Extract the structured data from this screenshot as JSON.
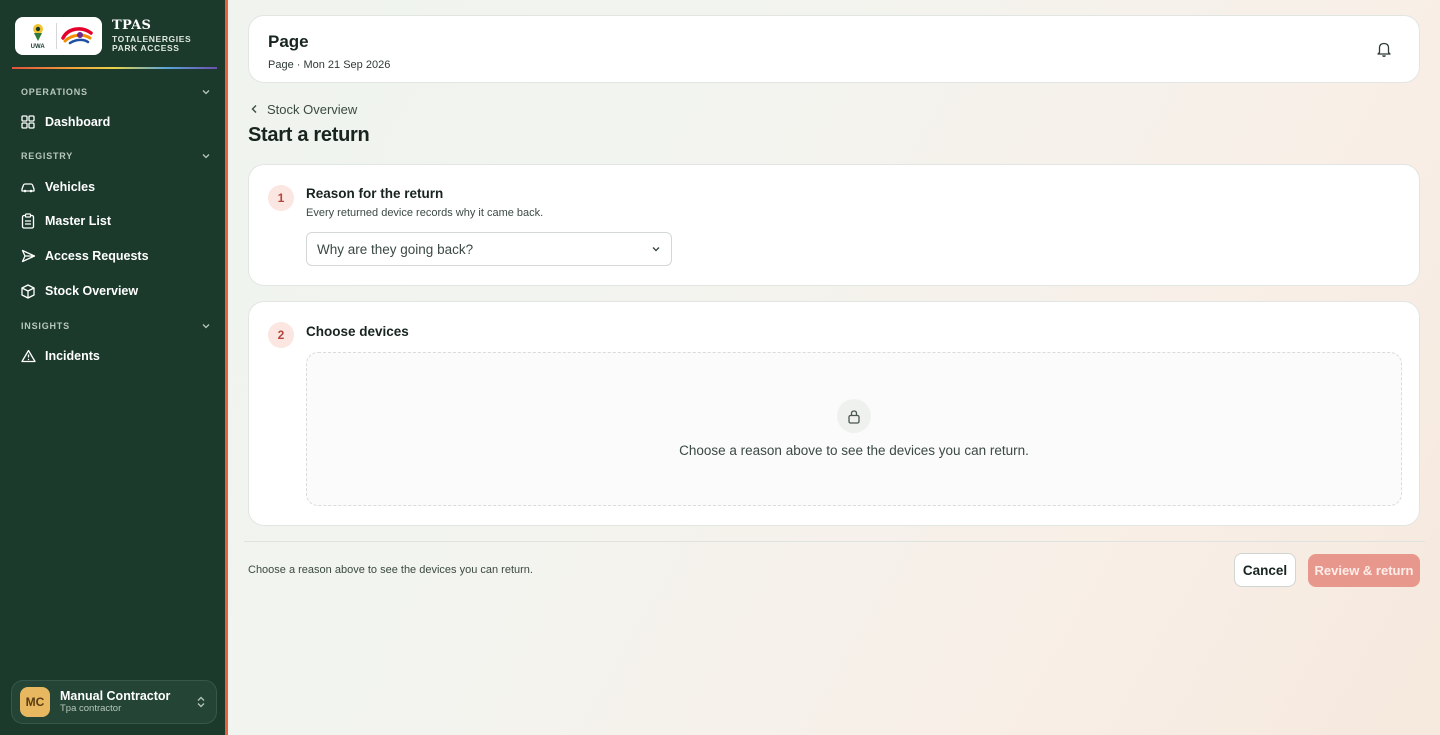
{
  "sidebar": {
    "brand": {
      "logo_badge": "UWA",
      "title": "TPAS",
      "subtitle_line1": "TOTALENERGIES",
      "subtitle_line2": "PARK ACCESS"
    },
    "sections": [
      {
        "label": "OPERATIONS"
      },
      {
        "label": "REGISTRY"
      },
      {
        "label": "INSIGHTS"
      }
    ],
    "items": [
      {
        "label": "Dashboard",
        "icon": "grid-icon"
      },
      {
        "label": "Vehicles",
        "icon": "car-icon"
      },
      {
        "label": "Master List",
        "icon": "clipboard-icon"
      },
      {
        "label": "Access Requests",
        "icon": "send-icon"
      },
      {
        "label": "Stock Overview",
        "icon": "package-icon"
      },
      {
        "label": "Incidents",
        "icon": "alert-triangle-icon"
      }
    ],
    "user": {
      "initials": "MC",
      "name": "Manual Contractor",
      "role": "Tpa contractor"
    }
  },
  "header": {
    "title": "Page",
    "subtitle": "Page · Mon 21 Sep 2026",
    "icon": "bell-icon"
  },
  "breadcrumb": {
    "back_label": "Stock Overview"
  },
  "page_title": "Start a return",
  "steps": [
    {
      "number": "1",
      "title": "Reason for the return",
      "description": "Every returned device records why it came back.",
      "select_placeholder": "Why are they going back?"
    },
    {
      "number": "2",
      "title": "Choose devices",
      "empty_message": "Choose a reason above to see the devices you can return.",
      "empty_icon": "lock-icon"
    }
  ],
  "footer": {
    "hint": "Choose a reason above to see the devices you can return.",
    "cancel_label": "Cancel",
    "submit_label": "Review & return"
  },
  "colors": {
    "sidebar_bg": "#1b3a2c",
    "accent": "#e9603c",
    "primary_disabled": "#e8978c",
    "step_badge_bg": "#fbe6e1",
    "step_badge_text": "#b4453a"
  }
}
